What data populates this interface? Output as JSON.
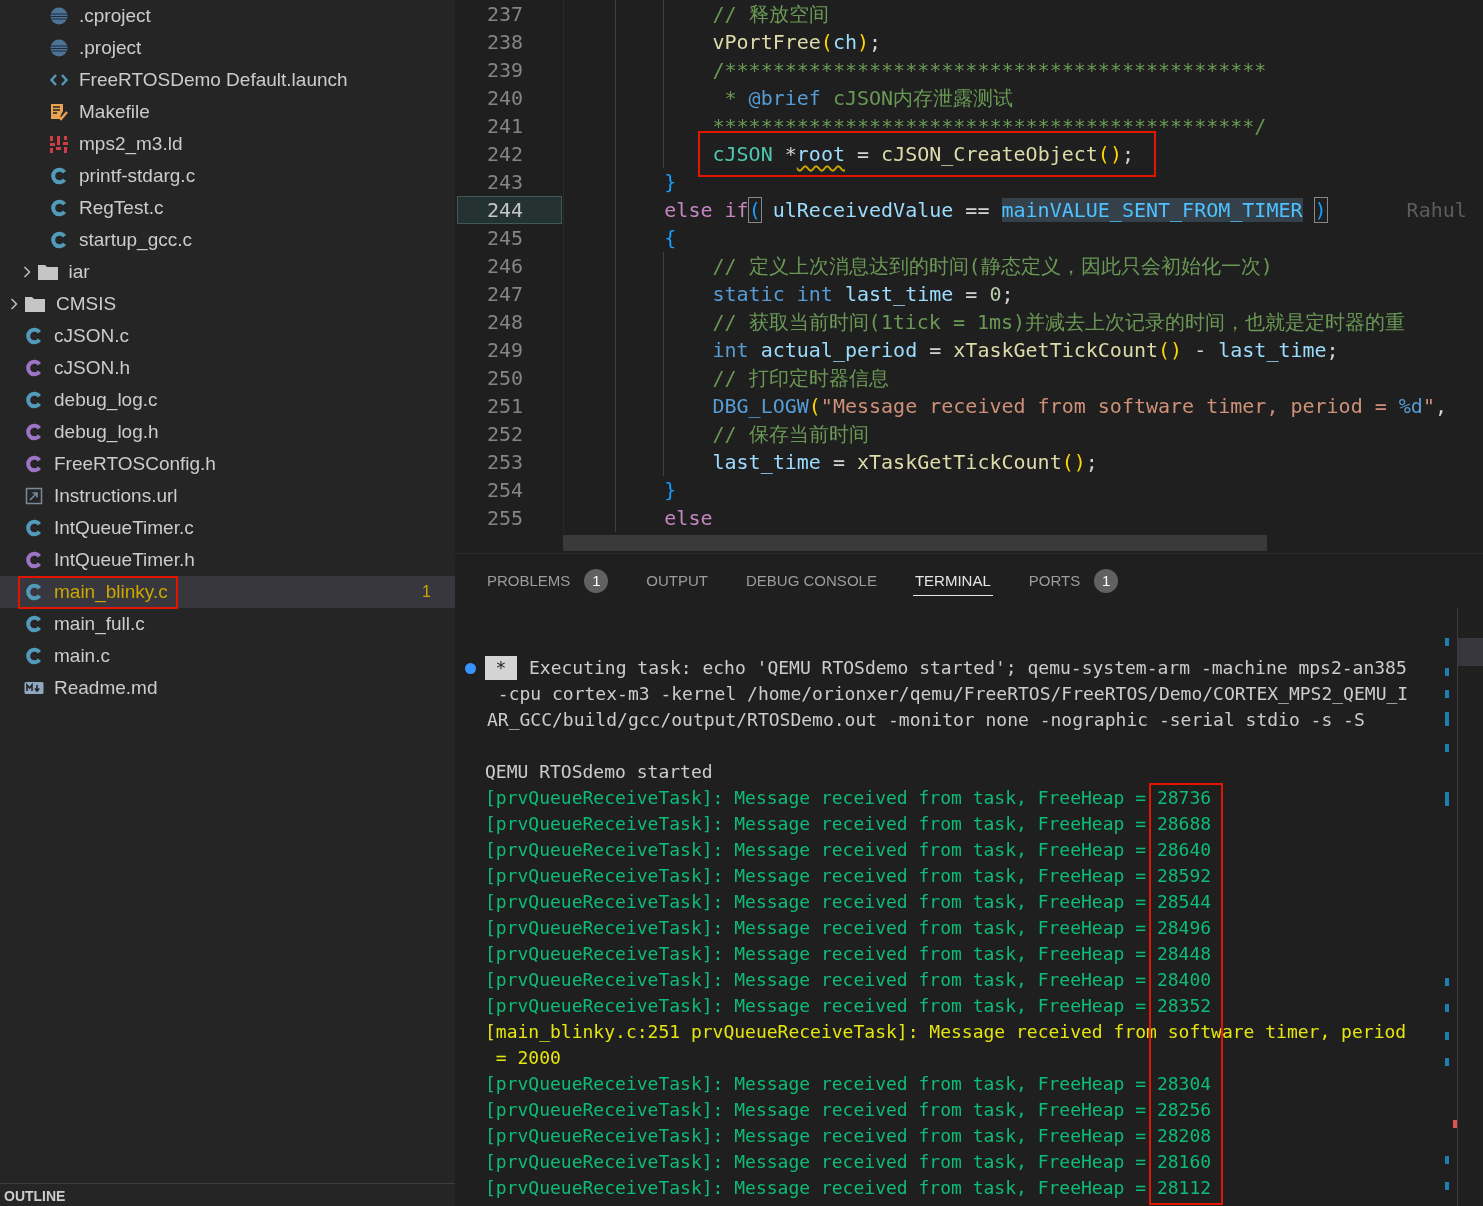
{
  "explorer": {
    "items": [
      {
        "kind": "group",
        "children": [
          {
            "kind": "group",
            "children": [
              {
                "kind": "eclipse",
                "label": ".cproject",
                "selected": false,
                "warning": false,
                "boxed": false
              },
              {
                "kind": "eclipse",
                "label": ".project",
                "selected": false,
                "warning": false,
                "boxed": false
              },
              {
                "kind": "xml",
                "label": "FreeRTOSDemo Default.launch",
                "selected": false,
                "warning": false,
                "boxed": false
              },
              {
                "kind": "makefile",
                "label": "Makefile",
                "selected": false,
                "warning": false,
                "boxed": false
              },
              {
                "kind": "linker",
                "label": "mps2_m3.ld",
                "selected": false,
                "warning": false,
                "boxed": false
              },
              {
                "kind": "c",
                "label": "printf-stdarg.c",
                "selected": false,
                "warning": false,
                "boxed": false
              },
              {
                "kind": "c",
                "label": "RegTest.c",
                "selected": false,
                "warning": false,
                "boxed": false
              },
              {
                "kind": "c",
                "label": "startup_gcc.c",
                "selected": false,
                "warning": false,
                "boxed": false
              }
            ]
          },
          {
            "kind": "folder",
            "label": "iar",
            "expanded": false,
            "selected": false
          }
        ]
      },
      {
        "kind": "folder",
        "label": "CMSIS",
        "expanded": false,
        "selected": false
      },
      {
        "kind": "c",
        "label": "cJSON.c",
        "selected": false,
        "warning": false,
        "boxed": false
      },
      {
        "kind": "h",
        "label": "cJSON.h",
        "selected": false,
        "warning": false,
        "boxed": false
      },
      {
        "kind": "c",
        "label": "debug_log.c",
        "selected": false,
        "warning": false,
        "boxed": false
      },
      {
        "kind": "h",
        "label": "debug_log.h",
        "selected": false,
        "warning": false,
        "boxed": false
      },
      {
        "kind": "h",
        "label": "FreeRTOSConfig.h",
        "selected": false,
        "warning": false,
        "boxed": false
      },
      {
        "kind": "url",
        "label": "Instructions.url",
        "selected": false,
        "warning": false,
        "boxed": false
      },
      {
        "kind": "c",
        "label": "IntQueueTimer.c",
        "selected": false,
        "warning": false,
        "boxed": false
      },
      {
        "kind": "h",
        "label": "IntQueueTimer.h",
        "selected": false,
        "warning": false,
        "boxed": false
      },
      {
        "kind": "c",
        "label": "main_blinky.c",
        "selected": true,
        "warning": true,
        "boxed": true,
        "problems": "1"
      },
      {
        "kind": "c",
        "label": "main_full.c",
        "selected": false,
        "warning": false,
        "boxed": false
      },
      {
        "kind": "c",
        "label": "main.c",
        "selected": false,
        "warning": false,
        "boxed": false
      },
      {
        "kind": "md",
        "label": "Readme.md",
        "selected": false,
        "warning": false,
        "boxed": false
      }
    ]
  },
  "outline": {
    "title": "OUTLINE"
  },
  "editor": {
    "lines": [
      {
        "number": "237",
        "kind": "inner",
        "current": false,
        "boxed": false,
        "tokens": [
          {
            "kind": "cmt",
            "text": "// 释放空间"
          }
        ]
      },
      {
        "number": "238",
        "kind": "inner",
        "current": false,
        "boxed": false,
        "tokens": [
          {
            "kind": "fn",
            "text": "vPortFree"
          },
          {
            "kind": "br",
            "text": "("
          },
          {
            "kind": "var",
            "text": "ch"
          },
          {
            "kind": "br",
            "text": ")"
          },
          {
            "kind": "p",
            "text": ";"
          }
        ]
      },
      {
        "number": "239",
        "kind": "inner",
        "current": false,
        "boxed": false,
        "tokens": [
          {
            "kind": "cmt",
            "text": "/*********************************************"
          }
        ]
      },
      {
        "number": "240",
        "kind": "inner",
        "current": false,
        "boxed": false,
        "tokens": [
          {
            "kind": "cmt",
            "text": " * "
          },
          {
            "kind": "doc",
            "text": "@brief"
          },
          {
            "kind": "cmt",
            "text": " cJSON内存泄露测试"
          }
        ]
      },
      {
        "number": "241",
        "kind": "inner",
        "current": false,
        "boxed": false,
        "tokens": [
          {
            "kind": "cmt",
            "text": "*********************************************/"
          }
        ]
      },
      {
        "number": "242",
        "kind": "inner",
        "current": false,
        "boxed": true,
        "tokens": [
          {
            "kind": "type",
            "text": "cJSON"
          },
          {
            "kind": "p",
            "text": " *"
          },
          {
            "kind": "varwarn",
            "text": "root"
          },
          {
            "kind": "p",
            "text": " = "
          },
          {
            "kind": "fn",
            "text": "cJSON_CreateObject"
          },
          {
            "kind": "br",
            "text": "()"
          },
          {
            "kind": "p",
            "text": ";"
          }
        ]
      },
      {
        "number": "243",
        "kind": "outer",
        "current": false,
        "boxed": false,
        "tokens": [
          {
            "kind": "brace",
            "text": "}"
          }
        ]
      },
      {
        "number": "244",
        "kind": "outer",
        "current": true,
        "boxed": false,
        "blame": "Rahul",
        "tokens": [
          {
            "kind": "kw",
            "text": "else if"
          },
          {
            "kind": "bm",
            "text": "("
          },
          {
            "kind": "var",
            "text": " ulReceivedValue"
          },
          {
            "kind": "p",
            "text": " == "
          },
          {
            "kind": "hl",
            "text": "mainVALUE_SENT_FROM_TIMER"
          },
          {
            "kind": "bm",
            "text": ")"
          }
        ]
      },
      {
        "number": "245",
        "kind": "outer",
        "current": false,
        "boxed": false,
        "tokens": [
          {
            "kind": "brace",
            "text": "{"
          }
        ]
      },
      {
        "number": "246",
        "kind": "inner",
        "current": false,
        "boxed": false,
        "tokens": [
          {
            "kind": "cmt",
            "text": "// 定义上次消息达到的时间(静态定义，因此只会初始化一次)"
          }
        ]
      },
      {
        "number": "247",
        "kind": "inner",
        "current": false,
        "boxed": false,
        "tokens": [
          {
            "kind": "stor",
            "text": "static int"
          },
          {
            "kind": "var",
            "text": " last_time"
          },
          {
            "kind": "p",
            "text": " = "
          },
          {
            "kind": "num",
            "text": "0"
          },
          {
            "kind": "p",
            "text": ";"
          }
        ]
      },
      {
        "number": "248",
        "kind": "inner",
        "current": false,
        "boxed": false,
        "tokens": [
          {
            "kind": "cmt",
            "text": "// 获取当前时间(1tick = 1ms)并减去上次记录的时间，也就是定时器的重"
          }
        ]
      },
      {
        "number": "249",
        "kind": "inner",
        "current": false,
        "boxed": false,
        "tokens": [
          {
            "kind": "stor",
            "text": "int"
          },
          {
            "kind": "var",
            "text": " actual_period"
          },
          {
            "kind": "p",
            "text": " = "
          },
          {
            "kind": "fn",
            "text": "xTaskGetTickCount"
          },
          {
            "kind": "br",
            "text": "()"
          },
          {
            "kind": "p",
            "text": " - "
          },
          {
            "kind": "var",
            "text": "last_time"
          },
          {
            "kind": "p",
            "text": ";"
          }
        ]
      },
      {
        "number": "250",
        "kind": "inner",
        "current": false,
        "boxed": false,
        "tokens": [
          {
            "kind": "cmt",
            "text": "// 打印定时器信息"
          }
        ]
      },
      {
        "number": "251",
        "kind": "inner",
        "current": false,
        "boxed": false,
        "tokens": [
          {
            "kind": "macro",
            "text": "DBG_LOGW"
          },
          {
            "kind": "br",
            "text": "("
          },
          {
            "kind": "str",
            "text": "\"Message received from software timer, period = "
          },
          {
            "kind": "fmt",
            "text": "%d"
          },
          {
            "kind": "str",
            "text": "\""
          },
          {
            "kind": "p",
            "text": ","
          }
        ]
      },
      {
        "number": "252",
        "kind": "inner",
        "current": false,
        "boxed": false,
        "tokens": [
          {
            "kind": "cmt",
            "text": "// 保存当前时间"
          }
        ]
      },
      {
        "number": "253",
        "kind": "inner",
        "current": false,
        "boxed": false,
        "tokens": [
          {
            "kind": "var",
            "text": "last_time"
          },
          {
            "kind": "p",
            "text": " = "
          },
          {
            "kind": "fn",
            "text": "xTaskGetTickCount"
          },
          {
            "kind": "br",
            "text": "()"
          },
          {
            "kind": "p",
            "text": ";"
          }
        ]
      },
      {
        "number": "254",
        "kind": "outer",
        "current": false,
        "boxed": false,
        "tokens": [
          {
            "kind": "brace",
            "text": "}"
          }
        ]
      },
      {
        "number": "255",
        "kind": "outer",
        "current": false,
        "boxed": false,
        "tokens": [
          {
            "kind": "kw",
            "text": "else"
          }
        ]
      }
    ]
  },
  "panel": {
    "tabs": [
      {
        "label": "PROBLEMS",
        "selected": false,
        "badge": "1"
      },
      {
        "label": "OUTPUT",
        "selected": false
      },
      {
        "label": "DEBUG CONSOLE",
        "selected": false
      },
      {
        "label": "TERMINAL",
        "selected": true
      },
      {
        "label": "PORTS",
        "selected": false,
        "badge": "1"
      }
    ],
    "terminal": {
      "heap_box": true,
      "rows": [
        {
          "kind": "task",
          "badge": "*",
          "text": "Executing task: echo 'QEMU RTOSdemo started'; qemu-system-arm -machine mps2-an385"
        },
        {
          "kind": "wrap",
          "text": " -cpu cortex-m3 -kernel /home/orionxer/qemu/FreeRTOS/FreeRTOS/Demo/CORTEX_MPS2_QEMU_I"
        },
        {
          "kind": "wrap",
          "text": "AR_GCC/build/gcc/output/RTOSDemo.out -monitor none -nographic -serial stdio -s -S"
        },
        {
          "kind": "output",
          "text": "QEMU RTOSdemo started"
        },
        {
          "kind": "heap",
          "text": "[prvQueueReceiveTask]: Message received from task, FreeHeap =",
          "value": "28736"
        },
        {
          "kind": "heap",
          "text": "[prvQueueReceiveTask]: Message received from task, FreeHeap =",
          "value": "28688"
        },
        {
          "kind": "heap",
          "text": "[prvQueueReceiveTask]: Message received from task, FreeHeap =",
          "value": "28640"
        },
        {
          "kind": "heap",
          "text": "[prvQueueReceiveTask]: Message received from task, FreeHeap =",
          "value": "28592"
        },
        {
          "kind": "heap",
          "text": "[prvQueueReceiveTask]: Message received from task, FreeHeap =",
          "value": "28544"
        },
        {
          "kind": "heap",
          "text": "[prvQueueReceiveTask]: Message received from task, FreeHeap =",
          "value": "28496"
        },
        {
          "kind": "heap",
          "text": "[prvQueueReceiveTask]: Message received from task, FreeHeap =",
          "value": "28448"
        },
        {
          "kind": "heap",
          "text": "[prvQueueReceiveTask]: Message received from task, FreeHeap =",
          "value": "28400"
        },
        {
          "kind": "heap",
          "text": "[prvQueueReceiveTask]: Message received from task, FreeHeap =",
          "value": "28352"
        },
        {
          "kind": "log",
          "text": "[main_blinky.c:251 prvQueueReceiveTask]: Message received from software timer, period"
        },
        {
          "kind": "log",
          "text": " = 2000"
        },
        {
          "kind": "heap",
          "text": "[prvQueueReceiveTask]: Message received from task, FreeHeap =",
          "value": "28304"
        },
        {
          "kind": "heap",
          "text": "[prvQueueReceiveTask]: Message received from task, FreeHeap =",
          "value": "28256"
        },
        {
          "kind": "heap",
          "text": "[prvQueueReceiveTask]: Message received from task, FreeHeap =",
          "value": "28208"
        },
        {
          "kind": "heap",
          "text": "[prvQueueReceiveTask]: Message received from task, FreeHeap =",
          "value": "28160"
        },
        {
          "kind": "heap",
          "text": "[prvQueueReceiveTask]: Message received from task, FreeHeap =",
          "value": "28112"
        }
      ]
    }
  }
}
